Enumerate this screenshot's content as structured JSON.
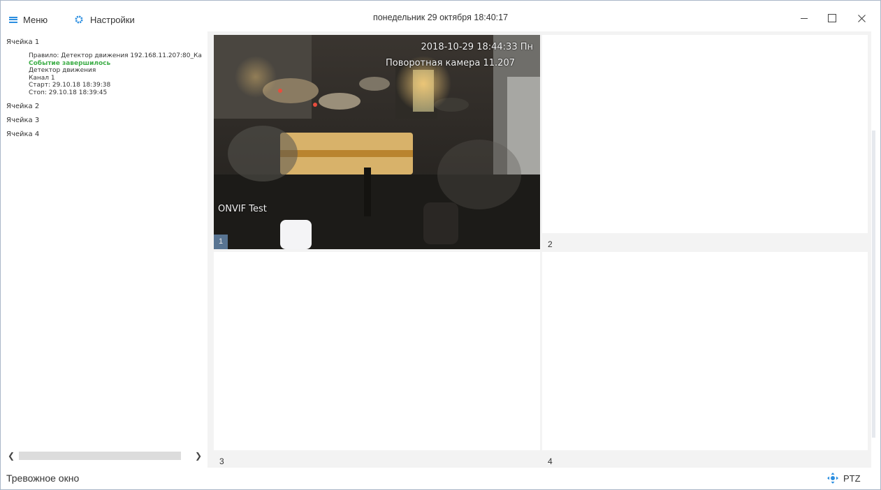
{
  "titlebar": {
    "menu_label": "Меню",
    "settings_label": "Настройки",
    "datetime": "понедельник 29 октября 18:40:17"
  },
  "alarms": {
    "cells": [
      {
        "title": "Ячейка 1",
        "event": {
          "rule": "Правило: Детектор движения 192.168.11.207:80_Ка",
          "status": "Событие завершилось",
          "type": "Детектор движения",
          "channel": "Канал 1",
          "start": "Старт: 29.10.18 18:39:38",
          "stop": "Стоп: 29.10.18 18:39:45"
        }
      },
      {
        "title": "Ячейка 2"
      },
      {
        "title": "Ячейка 3"
      },
      {
        "title": "Ячейка 4"
      }
    ]
  },
  "grid": {
    "cell1": {
      "number": "1",
      "osd_time": "2018-10-29 18:44:33 Пн",
      "osd_camera": "Поворотная камера 11.207",
      "osd_name": "ONVIF Test"
    },
    "cell2": {
      "number": "2"
    },
    "cell3": {
      "number": "3"
    },
    "cell4": {
      "number": "4"
    }
  },
  "footer": {
    "alarm_window_label": "Тревожное окно",
    "ptz_label": "PTZ"
  },
  "colors": {
    "accent": "#2b8ee0",
    "status_ok": "#3fae49"
  }
}
